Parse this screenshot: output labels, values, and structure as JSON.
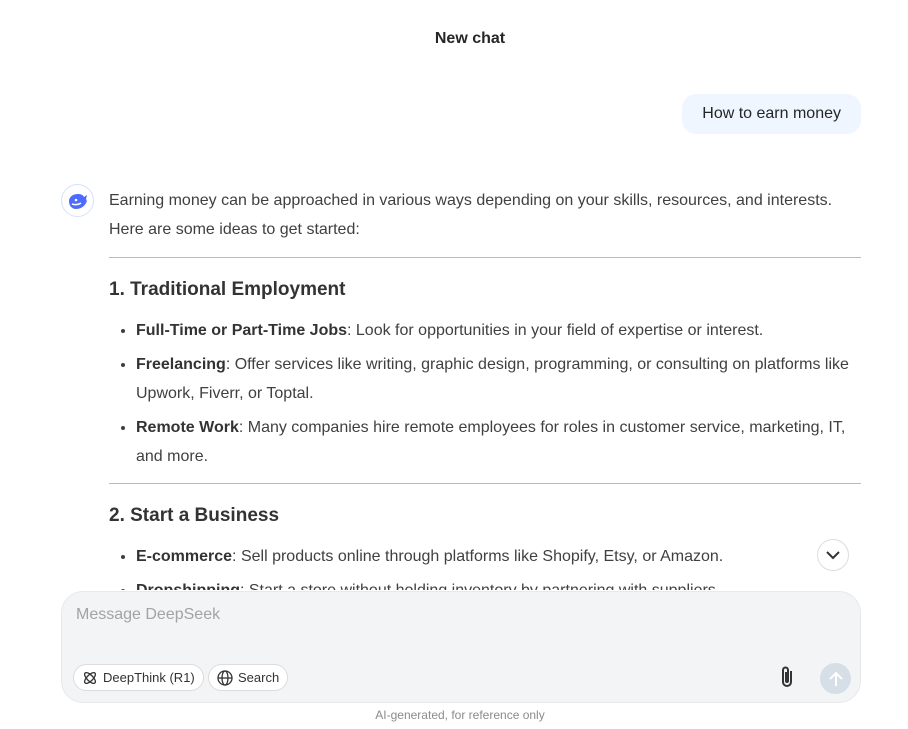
{
  "header": {
    "title": "New chat"
  },
  "user_message": "How to earn money",
  "response": {
    "intro": "Earning money can be approached in various ways depending on your skills, resources, and interests. Here are some ideas to get started:",
    "sections": [
      {
        "heading": "1. Traditional Employment",
        "items": [
          {
            "term": "Full-Time or Part-Time Jobs",
            "text": ": Look for opportunities in your field of expertise or interest."
          },
          {
            "term": "Freelancing",
            "text": ": Offer services like writing, graphic design, programming, or consulting on platforms like Upwork, Fiverr, or Toptal."
          },
          {
            "term": "Remote Work",
            "text": ": Many companies hire remote employees for roles in customer service, marketing, IT, and more."
          }
        ]
      },
      {
        "heading": "2. Start a Business",
        "items": [
          {
            "term": "E-commerce",
            "text": ": Sell products online through platforms like Shopify, Etsy, or Amazon."
          },
          {
            "term": "Dropshipping",
            "text": ": Start a store without holding inventory by partnering with suppliers."
          }
        ]
      }
    ]
  },
  "input": {
    "placeholder": "Message DeepSeek",
    "deepthink_label": "DeepThink (R1)",
    "search_label": "Search"
  },
  "footer": "AI-generated, for reference only",
  "colors": {
    "accent": "#4d6bfe",
    "user_bubble": "#eff6ff",
    "send_disabled": "#d6dee8"
  }
}
